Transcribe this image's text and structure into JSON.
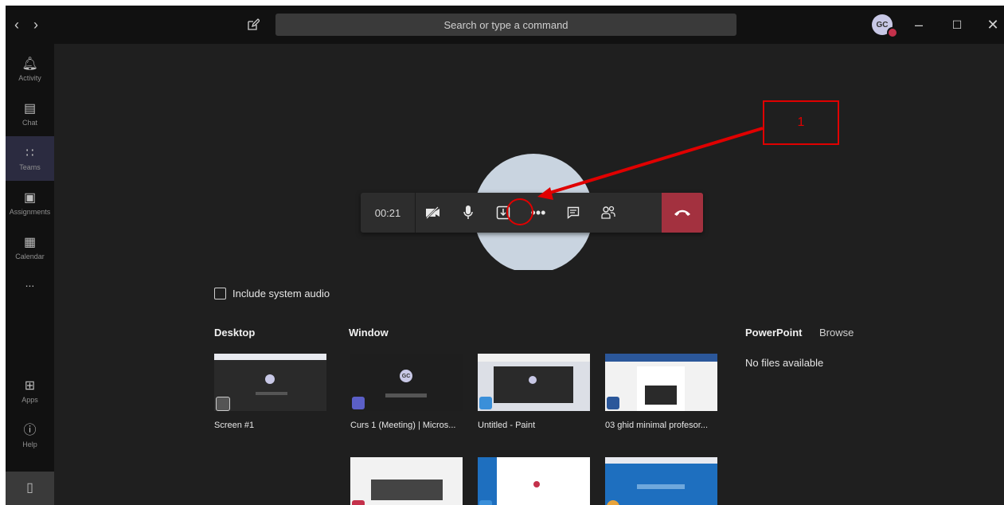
{
  "titlebar": {
    "search_placeholder": "Search or type a command",
    "avatar_initials": "GC"
  },
  "rail": {
    "items": [
      {
        "label": "Activity"
      },
      {
        "label": "Chat"
      },
      {
        "label": "Teams"
      },
      {
        "label": "Assignments"
      },
      {
        "label": "Calendar"
      },
      {
        "label": "..."
      },
      {
        "label": "Apps"
      },
      {
        "label": "Help"
      }
    ]
  },
  "meeting": {
    "timer": "00:21"
  },
  "annotation": {
    "label": "1"
  },
  "share": {
    "include_audio_label": "Include system audio",
    "desktop_title": "Desktop",
    "window_title": "Window",
    "powerpoint_title": "PowerPoint",
    "browse_label": "Browse",
    "no_files": "No files available",
    "desktop_captions": [
      "Screen #1"
    ],
    "window_captions": [
      "Curs 1 (Meeting) | Micros...",
      "Untitled - Paint",
      "03 ghid minimal profesor..."
    ],
    "avatar_initials_thumb": "GC"
  },
  "colors": {
    "accent": "#a3313f",
    "annotation": "#e00000",
    "rail_active": "#2b2b40"
  }
}
